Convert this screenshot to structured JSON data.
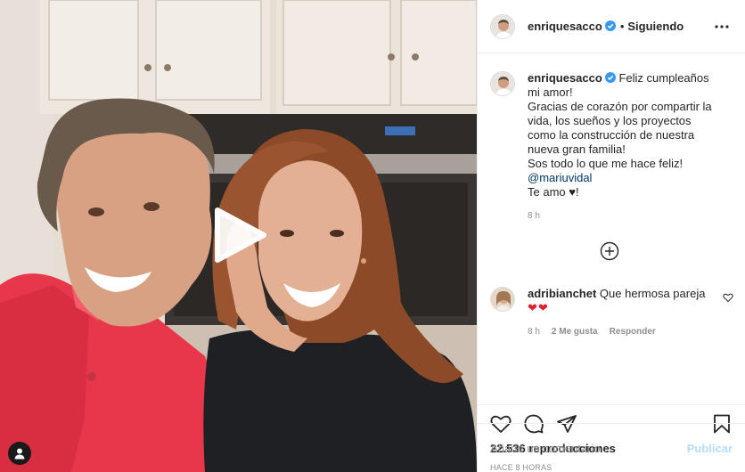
{
  "header": {
    "username": "enriquesacco",
    "separator": "•",
    "follow_state": "Siguiendo",
    "icons": {
      "verified": "verified-badge-icon",
      "more": "more-options-icon"
    }
  },
  "caption": {
    "username": "enriquesacco",
    "lines": [
      "Feliz cumpleaños mi amor!",
      "Gracias de corazón por compartir la vida, los sueños y los proyectos como la construcción de nuestra nueva gran familia!",
      "Sos todo lo que me hace feliz!"
    ],
    "mention": "@mariuvidal",
    "closing": "Te amo ♥!",
    "time": "8 h"
  },
  "load_more": {
    "icon": "plus-circle-icon"
  },
  "reply": {
    "username": "adribianchet",
    "text": "Que hermosa pareja",
    "emoji": "❤❤",
    "time": "8 h",
    "likes": "2 Me gusta",
    "reply_label": "Responder"
  },
  "stats": {
    "views": "22.536 reproducciones",
    "time_ago": "HACE 8 HORAS"
  },
  "comment_box": {
    "placeholder": "Añade un comentario...",
    "publish_label": "Publicar"
  },
  "colors": {
    "verified": "#3897f0",
    "heart": "#ed4956",
    "publish_disabled": "#b2dffc",
    "secondary_text": "#8e8e8e",
    "mention": "#00376b"
  },
  "media": {
    "type": "video",
    "icons": {
      "play": "play-icon",
      "user_tags": "user-tag-icon"
    }
  }
}
